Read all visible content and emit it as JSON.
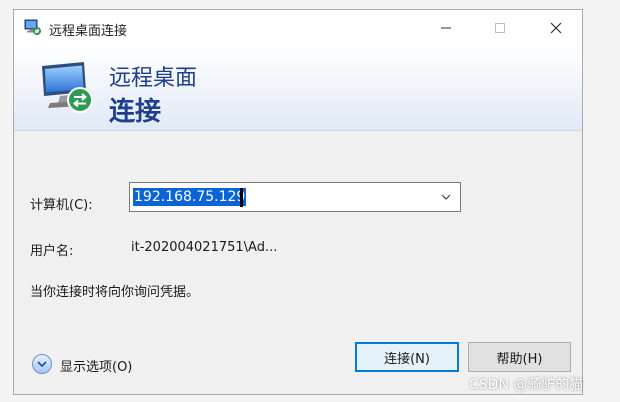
{
  "window": {
    "title": "远程桌面连接",
    "controls": {
      "minimize": "—",
      "maximize": "☐",
      "close": "✕"
    }
  },
  "banner": {
    "line1": "远程桌面",
    "line2": "连接"
  },
  "form": {
    "computer_label": "计算机(C):",
    "computer_value": "192.168.75.129",
    "user_label": "用户名:",
    "user_value": "it-202004021751\\Ad...",
    "note": "当你连接时将向你询问凭据。"
  },
  "footer": {
    "show_options": "显示选项(O)",
    "connect_button": "连接(N)",
    "help_button": "帮助(H)"
  },
  "watermark": "CSDN @骑驴的猫",
  "colors": {
    "accent": "#0078d7",
    "selection": "#0a64d8",
    "banner_text": "#1f3f8a"
  }
}
